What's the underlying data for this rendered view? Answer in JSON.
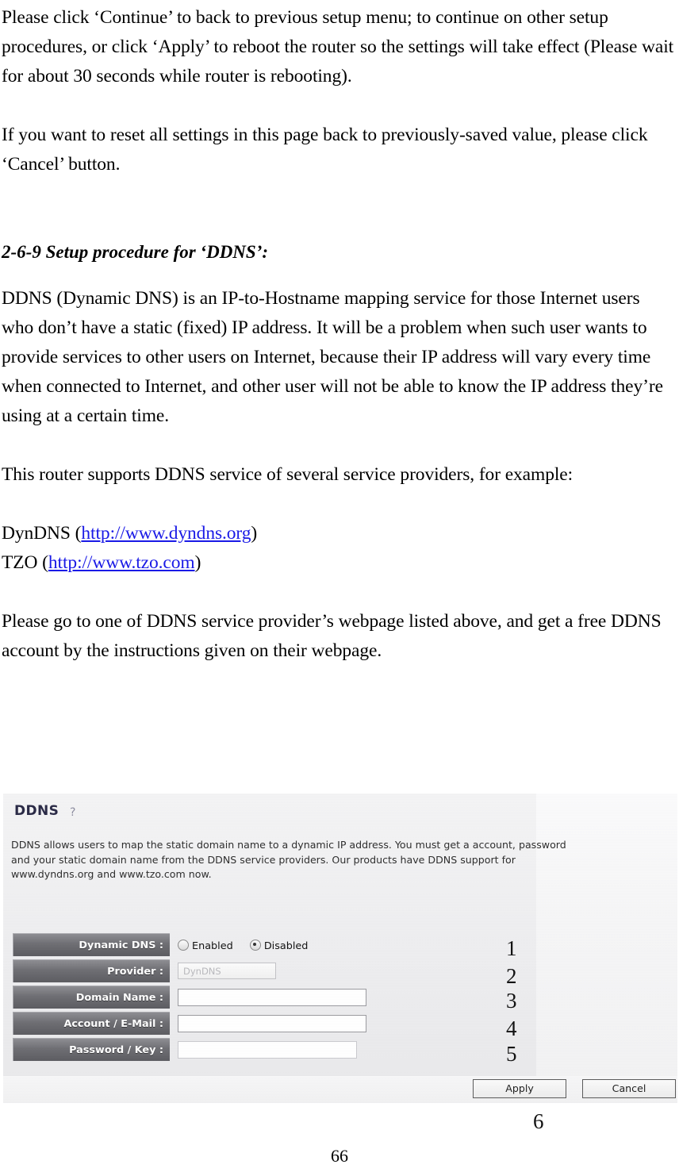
{
  "document": {
    "paragraphs": [
      "Please click ‘Continue’ to back to previous setup menu; to continue on other setup procedures, or click ‘Apply’ to reboot the router so the settings will take effect (Please wait for about 30 seconds while router is rebooting).",
      "If you want to reset all settings in this page back to previously-saved value, please click ‘Cancel’ button."
    ],
    "section_heading": "2-6-9 Setup procedure for ‘DDNS’:",
    "body_paragraphs": [
      "DDNS (Dynamic DNS) is an IP-to-Hostname mapping service for those Internet users who don’t have a static (fixed) IP address. It will be a problem when such user wants to provide services to other users on Internet, because their IP address will vary every time when connected to Internet, and other user will not be able to know the IP address they’re using at a certain time.",
      "This router supports DDNS service of several service providers, for example:"
    ],
    "providers": [
      {
        "name": "DynDNS",
        "url": "http://www.dyndns.org"
      },
      {
        "name": "TZO",
        "url": "http://www.tzo.com"
      }
    ],
    "closing_paragraph": "Please go to one of DDNS service provider’s webpage listed above, and get a free DDNS account by the instructions given on their webpage.",
    "page_number": "66",
    "link_color": "#1a1ae6"
  },
  "screenshot": {
    "panel_title": "DDNS",
    "help_icon": "question-mark-icon",
    "description": "DDNS allows users to map the static domain name to a dynamic IP address. You must get a account, password\nand your static domain name from the DDNS service providers. Our products have DDNS support for\nwww.dyndns.org and www.tzo.com now.",
    "form": {
      "rows": [
        {
          "label": "Dynamic DNS :",
          "type": "radio",
          "options": [
            {
              "label": "Enabled",
              "selected": false
            },
            {
              "label": "Disabled",
              "selected": true
            }
          ],
          "annotation": "1"
        },
        {
          "label": "Provider :",
          "type": "select",
          "value": "DynDNS",
          "annotation": "2"
        },
        {
          "label": "Domain Name :",
          "type": "text",
          "value": "",
          "annotation": "3"
        },
        {
          "label": "Account / E-Mail :",
          "type": "text",
          "value": "",
          "annotation": "4"
        },
        {
          "label": "Password / Key :",
          "type": "text",
          "value": "",
          "annotation": "5"
        }
      ]
    },
    "buttons": {
      "apply": "Apply",
      "cancel": "Cancel",
      "annotation": "6"
    },
    "colors": {
      "label_bg_dark": "#6e6e73",
      "title": "#2a2a46",
      "panel_bg": "#eeeef0"
    }
  }
}
